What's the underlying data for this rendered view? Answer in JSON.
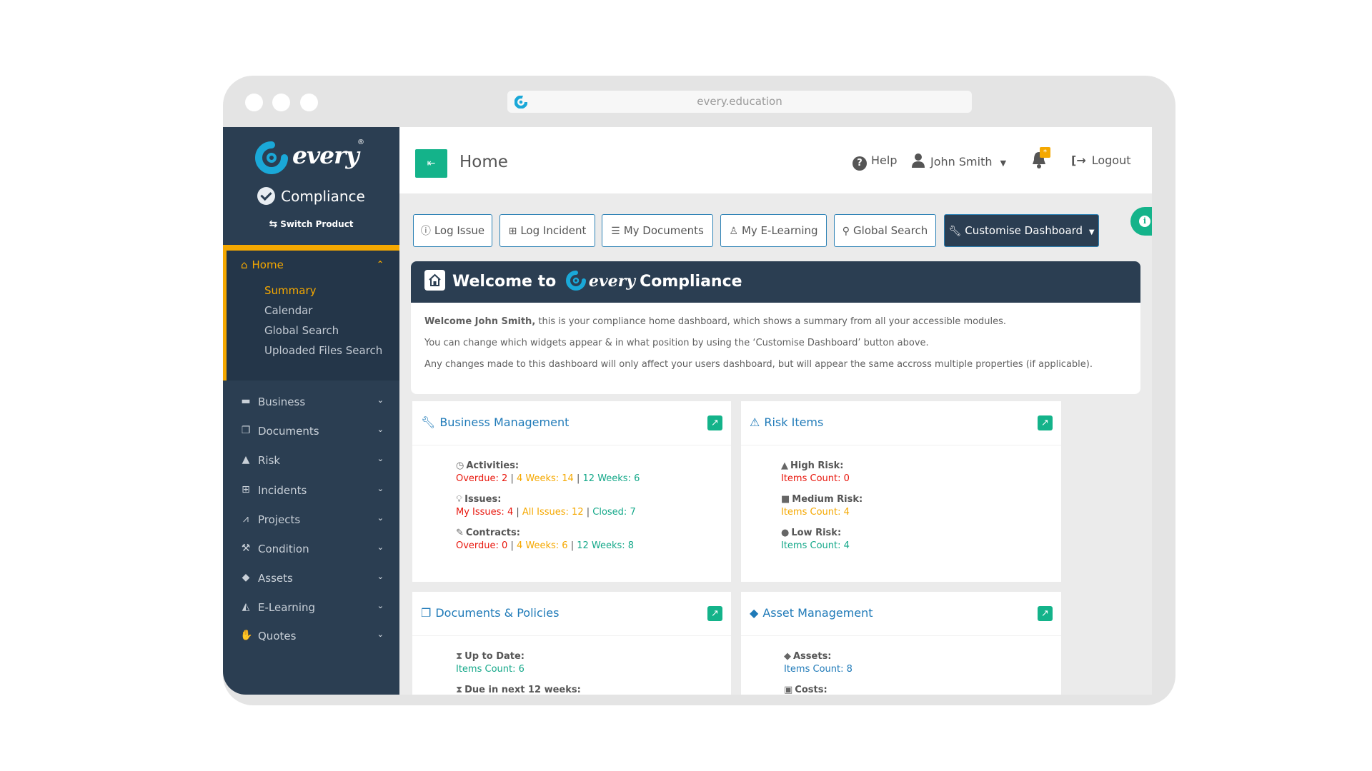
{
  "browser": {
    "url": "every.education"
  },
  "sidebar": {
    "brand_word": "every",
    "brand_reg": "®",
    "product": "Compliance",
    "switch_product": "Switch Product",
    "home": {
      "label": "Home",
      "subitems": [
        {
          "label": "Summary",
          "active": true
        },
        {
          "label": "Calendar"
        },
        {
          "label": "Global Search"
        },
        {
          "label": "Uploaded Files Search"
        }
      ]
    },
    "items": [
      {
        "label": "Business",
        "icon": "briefcase-icon"
      },
      {
        "label": "Documents",
        "icon": "files-icon"
      },
      {
        "label": "Risk",
        "icon": "warning-icon"
      },
      {
        "label": "Incidents",
        "icon": "medkit-icon"
      },
      {
        "label": "Projects",
        "icon": "chart-line-icon"
      },
      {
        "label": "Condition",
        "icon": "gavel-icon"
      },
      {
        "label": "Assets",
        "icon": "tags-icon"
      },
      {
        "label": "E-Learning",
        "icon": "graduation-cap-icon"
      },
      {
        "label": "Quotes",
        "icon": "handshake-icon"
      }
    ]
  },
  "header": {
    "title": "Home",
    "help": "Help",
    "user": "John Smith",
    "notification_badge": "*",
    "logout": "Logout"
  },
  "toolbar": {
    "buttons": [
      {
        "label": "Log Issue",
        "icon": "exclamation-circle-icon"
      },
      {
        "label": "Log Incident",
        "icon": "medkit-icon"
      },
      {
        "label": "My Documents",
        "icon": "checklist-icon"
      },
      {
        "label": "My E-Learning",
        "icon": "user-graduate-icon"
      },
      {
        "label": "Global Search",
        "icon": "search-icon"
      },
      {
        "label": "Customise Dashboard",
        "icon": "wrench-icon"
      }
    ]
  },
  "welcome": {
    "title_prefix": "Welcome to",
    "title_brand": "every",
    "title_suffix": "Compliance",
    "greeting_bold": "Welcome John Smith,",
    "greeting_rest": " this is your compliance home dashboard, which shows a summary from all your accessible modules.",
    "line2": "You can change which widgets appear & in what position by using the ‘Customise Dashboard’ button above.",
    "line3": "Any changes made to this dashboard will only affect your users dashboard, but will appear the same accross multiple properties (if applicable)."
  },
  "widgets": {
    "business": {
      "title": "Business Management",
      "activities": {
        "label": "Activities:",
        "a": "Overdue: 2",
        "b": "4 Weeks: 14",
        "c": "12 Weeks: 6"
      },
      "issues": {
        "label": "Issues:",
        "a": "My Issues: 4",
        "b": "All Issues: 12",
        "c": "Closed: 7"
      },
      "contracts": {
        "label": "Contracts:",
        "a": "Overdue: 0",
        "b": "4 Weeks: 6",
        "c": "12 Weeks: 8"
      },
      "separator": "|"
    },
    "risk": {
      "title": "Risk Items",
      "high": {
        "label": "High Risk:",
        "value": "Items Count: 0"
      },
      "medium": {
        "label": "Medium Risk:",
        "value": "Items Count: 4"
      },
      "low": {
        "label": "Low Risk:",
        "value": "Items Count: 4"
      }
    },
    "documents": {
      "title": "Documents & Policies",
      "up_to_date": {
        "label": "Up to Date:",
        "value": "Items Count: 6"
      },
      "due": {
        "label": "Due in next 12 weeks:"
      }
    },
    "assets": {
      "title": "Asset Management",
      "assets": {
        "label": "Assets:",
        "value": "Items Count: 8"
      },
      "costs": {
        "label": "Costs:"
      }
    }
  },
  "colors": {
    "sidebar": "#2b3e52",
    "accent_orange": "#f5a800",
    "accent_green": "#14b38a",
    "link_blue": "#1f7ab8",
    "danger": "#e8160c"
  }
}
